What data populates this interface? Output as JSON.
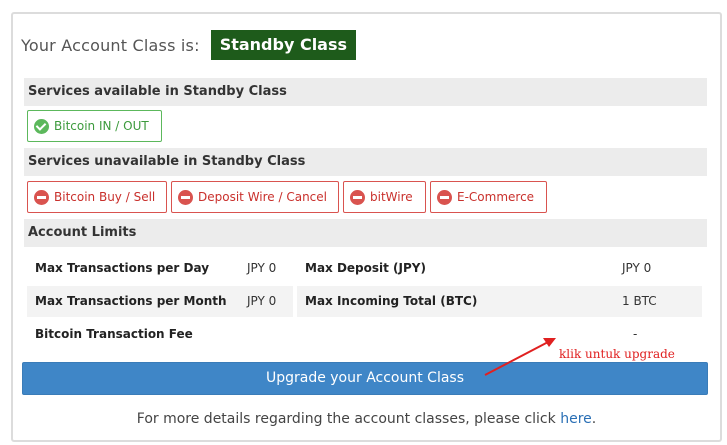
{
  "account_class": {
    "label": "Your Account Class is:",
    "value": "Standby Class"
  },
  "services_available": {
    "header": "Services available in Standby Class",
    "items": [
      {
        "label": "Bitcoin IN / OUT",
        "icon": "check-circle-icon"
      }
    ]
  },
  "services_unavailable": {
    "header": "Services unavailable in Standby Class",
    "items": [
      {
        "label": "Bitcoin Buy / Sell",
        "icon": "minus-circle-icon"
      },
      {
        "label": "Deposit Wire / Cancel",
        "icon": "minus-circle-icon"
      },
      {
        "label": "bitWire",
        "icon": "minus-circle-icon"
      },
      {
        "label": "E-Commerce",
        "icon": "minus-circle-icon"
      }
    ]
  },
  "account_limits": {
    "header": "Account Limits",
    "rows": [
      {
        "label": "Max Transactions per Day",
        "value": "JPY 0"
      },
      {
        "label": "Max Deposit (JPY)",
        "value": "JPY 0"
      },
      {
        "label": "Max Transactions per Month",
        "value": "JPY 0"
      },
      {
        "label": "Max Incoming Total (BTC)",
        "value": "1 BTC"
      },
      {
        "label": "Bitcoin Transaction Fee",
        "value": "-"
      }
    ]
  },
  "upgrade_button": "Upgrade your Account Class",
  "footer": {
    "text": "For more details regarding the account classes, please click ",
    "link": "here",
    "suffix": "."
  },
  "annotation": "klik untuk upgrade",
  "colors": {
    "badge": "#1e5b1b",
    "available": "#5cb85c",
    "unavailable": "#d9534f",
    "button": "#3f86c7",
    "annotation": "#e02020"
  }
}
